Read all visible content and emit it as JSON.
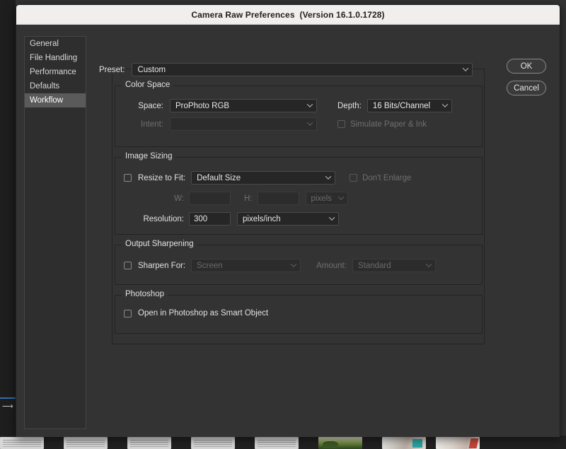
{
  "window": {
    "title": "Camera Raw Preferences  (Version 16.1.0.1728)"
  },
  "sidebar": {
    "items": [
      {
        "label": "General",
        "selected": false
      },
      {
        "label": "File Handling",
        "selected": false
      },
      {
        "label": "Performance",
        "selected": false
      },
      {
        "label": "Defaults",
        "selected": false
      },
      {
        "label": "Workflow",
        "selected": true
      }
    ]
  },
  "buttons": {
    "ok": "OK",
    "cancel": "Cancel"
  },
  "preset": {
    "label": "Preset:",
    "value": "Custom"
  },
  "color_space": {
    "legend": "Color Space",
    "space_label": "Space:",
    "space_value": "ProPhoto RGB",
    "depth_label": "Depth:",
    "depth_value": "16 Bits/Channel",
    "intent_label": "Intent:",
    "intent_value": "",
    "simulate_label": "Simulate Paper & Ink"
  },
  "image_sizing": {
    "legend": "Image Sizing",
    "resize_label": "Resize to Fit:",
    "resize_value": "Default Size",
    "dont_enlarge_label": "Don't Enlarge",
    "w_label": "W:",
    "w_value": "",
    "h_label": "H:",
    "h_value": "",
    "unit_value": "pixels",
    "resolution_label": "Resolution:",
    "resolution_value": "300",
    "resolution_unit": "pixels/inch"
  },
  "output_sharpening": {
    "legend": "Output Sharpening",
    "sharpen_label": "Sharpen For:",
    "sharpen_value": "Screen",
    "amount_label": "Amount:",
    "amount_value": "Standard"
  },
  "photoshop": {
    "legend": "Photoshop",
    "smart_object_label": "Open in Photoshop as Smart Object"
  },
  "colors": {
    "dialog_bg": "#333333",
    "titlebar_bg": "#f0efed",
    "field_bg": "#262626",
    "selection_bg": "#5a5a5a",
    "text": "#e2e2e2",
    "text_disabled": "#6b6b6b",
    "accent_rail": "#2f6fb0"
  },
  "filmstrip": {
    "thumbs": [
      {
        "kind": "doc",
        "width": 62
      },
      {
        "kind": "gap",
        "width": 24
      },
      {
        "kind": "doc",
        "width": 62
      },
      {
        "kind": "gap",
        "width": 24
      },
      {
        "kind": "doc",
        "width": 62
      },
      {
        "kind": "gap",
        "width": 24
      },
      {
        "kind": "doc",
        "width": 62
      },
      {
        "kind": "gap",
        "width": 24
      },
      {
        "kind": "doc",
        "width": 62
      },
      {
        "kind": "gap",
        "width": 24
      },
      {
        "kind": "nature",
        "width": 62
      },
      {
        "kind": "gap",
        "width": 24
      },
      {
        "kind": "photo",
        "width": 62
      },
      {
        "kind": "gap",
        "width": 10
      },
      {
        "kind": "photo2",
        "width": 62
      }
    ]
  }
}
